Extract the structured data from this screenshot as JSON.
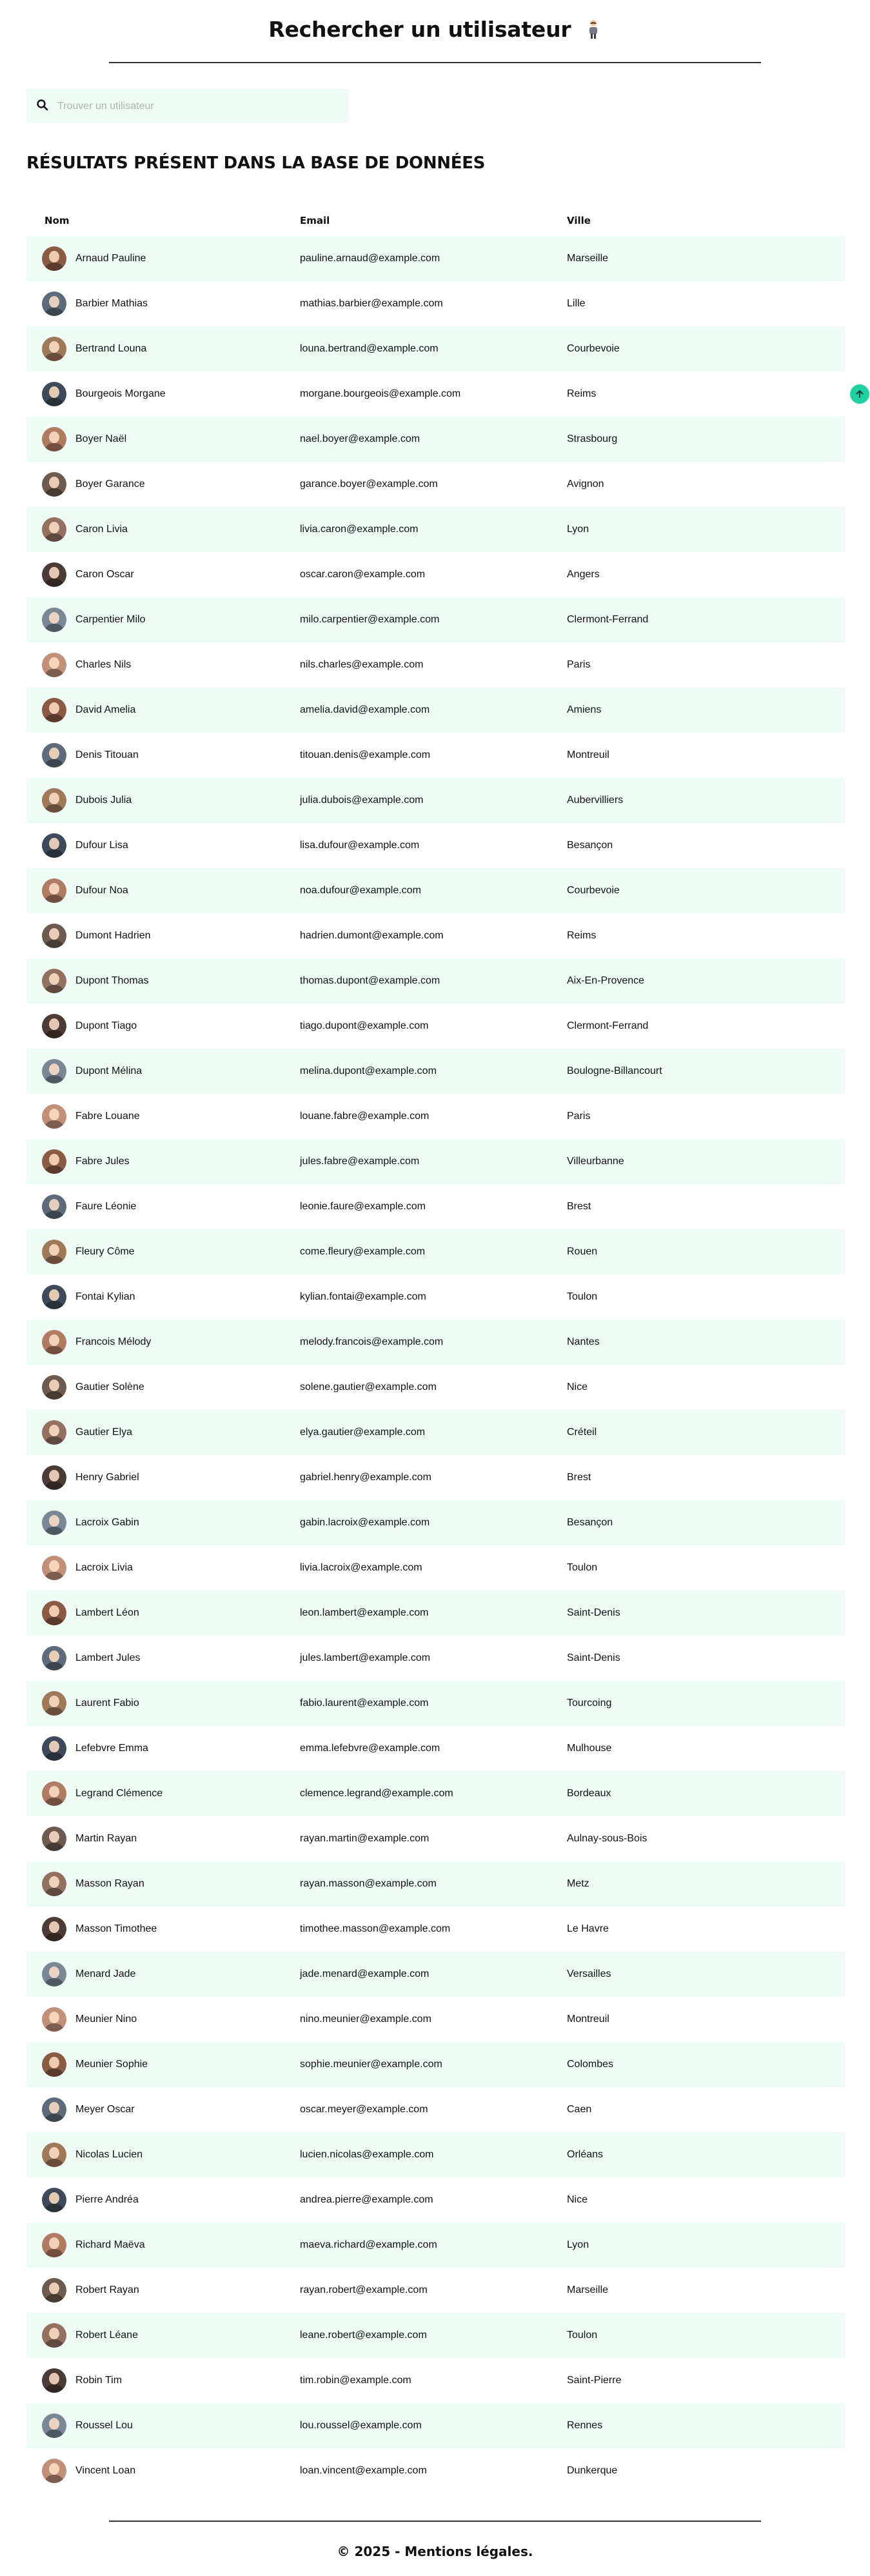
{
  "header": {
    "title": "Rechercher un utilisateur",
    "title_icon": "person-standing-icon"
  },
  "search": {
    "placeholder": "Trouver un utilisateur",
    "value": "",
    "icon": "search-icon"
  },
  "results": {
    "title": "RÉSULTATS PRÉSENT DANS LA BASE DE DONNÉES",
    "columns": [
      "Nom",
      "Email",
      "Ville"
    ],
    "rows": [
      {
        "name": "Arnaud Pauline",
        "email": "pauline.arnaud@example.com",
        "city": "Marseille"
      },
      {
        "name": "Barbier Mathias",
        "email": "mathias.barbier@example.com",
        "city": "Lille"
      },
      {
        "name": "Bertrand Louna",
        "email": "louna.bertrand@example.com",
        "city": "Courbevoie"
      },
      {
        "name": "Bourgeois Morgane",
        "email": "morgane.bourgeois@example.com",
        "city": "Reims"
      },
      {
        "name": "Boyer Naël",
        "email": "nael.boyer@example.com",
        "city": "Strasbourg"
      },
      {
        "name": "Boyer Garance",
        "email": "garance.boyer@example.com",
        "city": "Avignon"
      },
      {
        "name": "Caron Livia",
        "email": "livia.caron@example.com",
        "city": "Lyon"
      },
      {
        "name": "Caron Oscar",
        "email": "oscar.caron@example.com",
        "city": "Angers"
      },
      {
        "name": "Carpentier Milo",
        "email": "milo.carpentier@example.com",
        "city": "Clermont-Ferrand"
      },
      {
        "name": "Charles Nils",
        "email": "nils.charles@example.com",
        "city": "Paris"
      },
      {
        "name": "David Amelia",
        "email": "amelia.david@example.com",
        "city": "Amiens"
      },
      {
        "name": "Denis Titouan",
        "email": "titouan.denis@example.com",
        "city": "Montreuil"
      },
      {
        "name": "Dubois Julia",
        "email": "julia.dubois@example.com",
        "city": "Aubervilliers"
      },
      {
        "name": "Dufour Lisa",
        "email": "lisa.dufour@example.com",
        "city": "Besançon"
      },
      {
        "name": "Dufour Noa",
        "email": "noa.dufour@example.com",
        "city": "Courbevoie"
      },
      {
        "name": "Dumont Hadrien",
        "email": "hadrien.dumont@example.com",
        "city": "Reims"
      },
      {
        "name": "Dupont Thomas",
        "email": "thomas.dupont@example.com",
        "city": "Aix-En-Provence"
      },
      {
        "name": "Dupont Tiago",
        "email": "tiago.dupont@example.com",
        "city": "Clermont-Ferrand"
      },
      {
        "name": "Dupont Mélina",
        "email": "melina.dupont@example.com",
        "city": "Boulogne-Billancourt"
      },
      {
        "name": "Fabre Louane",
        "email": "louane.fabre@example.com",
        "city": "Paris"
      },
      {
        "name": "Fabre Jules",
        "email": "jules.fabre@example.com",
        "city": "Villeurbanne"
      },
      {
        "name": "Faure Léonie",
        "email": "leonie.faure@example.com",
        "city": "Brest"
      },
      {
        "name": "Fleury Côme",
        "email": "come.fleury@example.com",
        "city": "Rouen"
      },
      {
        "name": "Fontai Kylian",
        "email": "kylian.fontai@example.com",
        "city": "Toulon"
      },
      {
        "name": "Francois Mélody",
        "email": "melody.francois@example.com",
        "city": "Nantes"
      },
      {
        "name": "Gautier Solène",
        "email": "solene.gautier@example.com",
        "city": "Nice"
      },
      {
        "name": "Gautier Elya",
        "email": "elya.gautier@example.com",
        "city": "Créteil"
      },
      {
        "name": "Henry Gabriel",
        "email": "gabriel.henry@example.com",
        "city": "Brest"
      },
      {
        "name": "Lacroix Gabin",
        "email": "gabin.lacroix@example.com",
        "city": "Besançon"
      },
      {
        "name": "Lacroix Livia",
        "email": "livia.lacroix@example.com",
        "city": "Toulon"
      },
      {
        "name": "Lambert Léon",
        "email": "leon.lambert@example.com",
        "city": "Saint-Denis"
      },
      {
        "name": "Lambert Jules",
        "email": "jules.lambert@example.com",
        "city": "Saint-Denis"
      },
      {
        "name": "Laurent Fabio",
        "email": "fabio.laurent@example.com",
        "city": "Tourcoing"
      },
      {
        "name": "Lefebvre Emma",
        "email": "emma.lefebvre@example.com",
        "city": "Mulhouse"
      },
      {
        "name": "Legrand Clémence",
        "email": "clemence.legrand@example.com",
        "city": "Bordeaux"
      },
      {
        "name": "Martin Rayan",
        "email": "rayan.martin@example.com",
        "city": "Aulnay-sous-Bois"
      },
      {
        "name": "Masson Rayan",
        "email": "rayan.masson@example.com",
        "city": "Metz"
      },
      {
        "name": "Masson Timothee",
        "email": "timothee.masson@example.com",
        "city": "Le Havre"
      },
      {
        "name": "Menard Jade",
        "email": "jade.menard@example.com",
        "city": "Versailles"
      },
      {
        "name": "Meunier Nino",
        "email": "nino.meunier@example.com",
        "city": "Montreuil"
      },
      {
        "name": "Meunier Sophie",
        "email": "sophie.meunier@example.com",
        "city": "Colombes"
      },
      {
        "name": "Meyer Oscar",
        "email": "oscar.meyer@example.com",
        "city": "Caen"
      },
      {
        "name": "Nicolas Lucien",
        "email": "lucien.nicolas@example.com",
        "city": "Orléans"
      },
      {
        "name": "Pierre Andréa",
        "email": "andrea.pierre@example.com",
        "city": "Nice"
      },
      {
        "name": "Richard Maëva",
        "email": "maeva.richard@example.com",
        "city": "Lyon"
      },
      {
        "name": "Robert Rayan",
        "email": "rayan.robert@example.com",
        "city": "Marseille"
      },
      {
        "name": "Robert Léane",
        "email": "leane.robert@example.com",
        "city": "Toulon"
      },
      {
        "name": "Robin Tim",
        "email": "tim.robin@example.com",
        "city": "Saint-Pierre"
      },
      {
        "name": "Roussel Lou",
        "email": "lou.roussel@example.com",
        "city": "Rennes"
      },
      {
        "name": "Vincent Loan",
        "email": "loan.vincent@example.com",
        "city": "Dunkerque"
      }
    ]
  },
  "footer": {
    "text": "© 2025 - Mentions légales."
  },
  "scroll_top": {
    "icon": "arrow-up-icon"
  },
  "colors": {
    "accent": "#1fd1a0",
    "row_alt": "#eefcf5",
    "text": "#111111"
  }
}
